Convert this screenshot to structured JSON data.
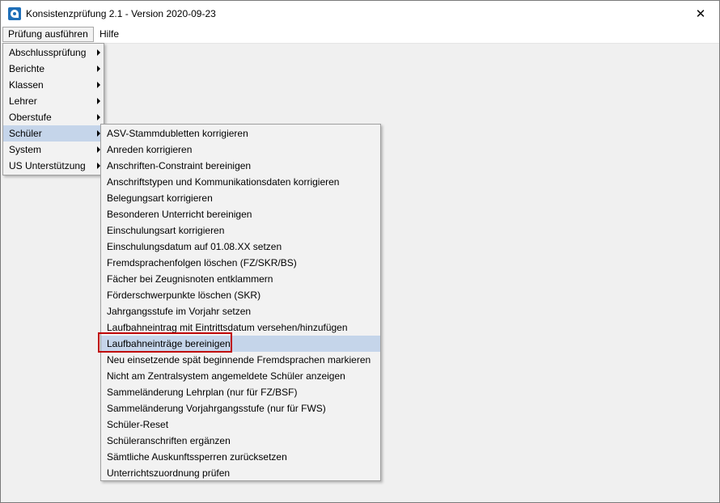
{
  "window": {
    "title": "Konsistenzprüfung 2.1 - Version 2020-09-23",
    "close_glyph": "✕"
  },
  "menubar": {
    "items": [
      {
        "label": "Prüfung ausführen"
      },
      {
        "label": "Hilfe"
      }
    ]
  },
  "main_menu": {
    "items": [
      {
        "label": "Abschlussprüfung"
      },
      {
        "label": "Berichte"
      },
      {
        "label": "Klassen"
      },
      {
        "label": "Lehrer"
      },
      {
        "label": "Oberstufe"
      },
      {
        "label": "Schüler"
      },
      {
        "label": "System"
      },
      {
        "label": "US Unterstützung"
      }
    ]
  },
  "schueler_menu": {
    "items": [
      {
        "label": "ASV-Stammdubletten korrigieren"
      },
      {
        "label": "Anreden korrigieren"
      },
      {
        "label": "Anschriften-Constraint bereinigen"
      },
      {
        "label": "Anschriftstypen und Kommunikationsdaten korrigieren"
      },
      {
        "label": "Belegungsart korrigieren"
      },
      {
        "label": "Besonderen Unterricht bereinigen"
      },
      {
        "label": "Einschulungsart korrigieren"
      },
      {
        "label": "Einschulungsdatum auf 01.08.XX setzen"
      },
      {
        "label": "Fremdsprachenfolgen löschen (FZ/SKR/BS)"
      },
      {
        "label": "Fächer bei Zeugnisnoten entklammern"
      },
      {
        "label": "Förderschwerpunkte löschen (SKR)"
      },
      {
        "label": "Jahrgangsstufe im Vorjahr setzen"
      },
      {
        "label": "Laufbahneintrag mit Eintrittsdatum versehen/hinzufügen"
      },
      {
        "label": "Laufbahneinträge bereinigen"
      },
      {
        "label": "Neu einsetzende spät beginnende Fremdsprachen markieren"
      },
      {
        "label": "Nicht am Zentralsystem angemeldete Schüler anzeigen"
      },
      {
        "label": "Sammeländerung Lehrplan (nur für FZ/BSF)"
      },
      {
        "label": "Sammeländerung Vorjahrgangsstufe (nur für FWS)"
      },
      {
        "label": "Schüler-Reset"
      },
      {
        "label": "Schüleranschriften ergänzen"
      },
      {
        "label": "Sämtliche Auskunftssperren zurücksetzen"
      },
      {
        "label": "Unterrichtszuordnung prüfen"
      }
    ]
  },
  "colors": {
    "hover": "#c5d5ea",
    "highlight_border": "#c00000"
  }
}
